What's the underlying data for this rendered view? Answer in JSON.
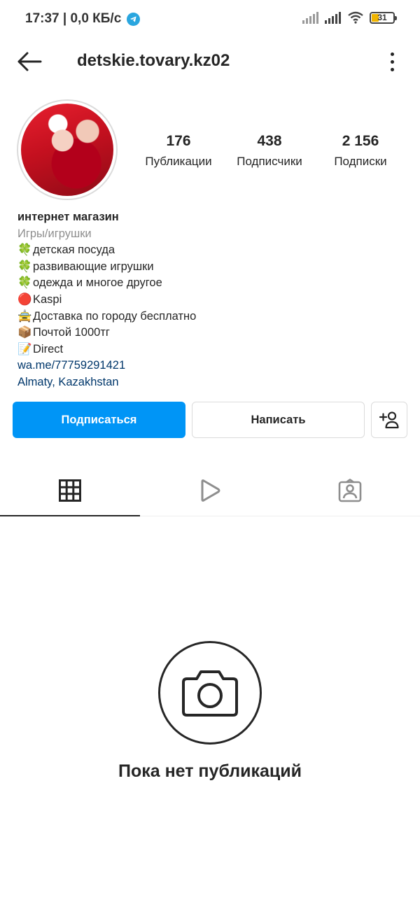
{
  "status_bar": {
    "time_and_speed": "17:37 | 0,0 КБ/с",
    "battery": "31"
  },
  "header": {
    "username": "detskie.tovary.kz02"
  },
  "stats": [
    {
      "value": "176",
      "label": "Публикации"
    },
    {
      "value": "438",
      "label": "Подписчики"
    },
    {
      "value": "2 156",
      "label": "Подписки"
    }
  ],
  "bio": {
    "name": "интернет магазин",
    "category": "Игры/игрушки",
    "lines": [
      {
        "emoji": "🍀",
        "text": "детская посуда"
      },
      {
        "emoji": "🍀",
        "text": "развивающие игрушки"
      },
      {
        "emoji": "🍀",
        "text": "одежда и многое другое"
      },
      {
        "emoji": "🔴",
        "text": "Kaspi"
      },
      {
        "emoji": "🚖",
        "text": "Доставка по городу бесплатно"
      },
      {
        "emoji": "📦",
        "text": "Почтой 1000тг"
      },
      {
        "emoji": "📝",
        "text": "Direct"
      }
    ],
    "link": "wa.me/77759291421",
    "location": "Almaty, Kazakhstan"
  },
  "actions": {
    "follow": "Подписаться",
    "message": "Написать"
  },
  "empty_state": {
    "text": "Пока нет публикаций"
  },
  "icons": {
    "back": "arrow-left-icon",
    "more": "more-vertical-icon",
    "grid": "grid-icon",
    "reels": "play-icon",
    "tagged": "tagged-user-icon",
    "suggest": "add-person-icon",
    "camera": "camera-icon"
  },
  "colors": {
    "accent": "#0095f6",
    "link": "#00376b",
    "muted": "#8e8e8e"
  }
}
